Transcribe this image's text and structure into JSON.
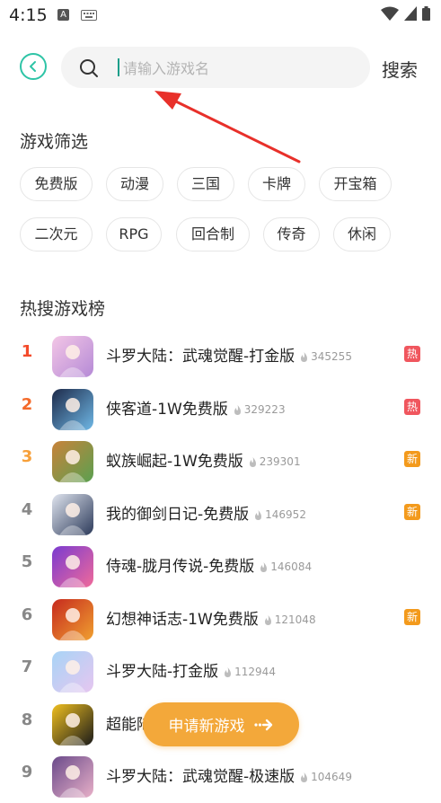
{
  "status_bar": {
    "time": "4:15",
    "a_icon": "A"
  },
  "search": {
    "placeholder": "请输入游戏名",
    "button_label": "搜索"
  },
  "filter": {
    "title": "游戏筛选",
    "tags": [
      "免费版",
      "动漫",
      "三国",
      "卡牌",
      "开宝箱",
      "二次元",
      "RPG",
      "回合制",
      "传奇",
      "休闲"
    ]
  },
  "ranking": {
    "title": "热搜游戏榜",
    "items": [
      {
        "rank": "1",
        "name": "斗罗大陆：武魂觉醒-打金版",
        "count": "345255",
        "badge": "热",
        "badge_color": "#f0565e",
        "thumb_colors": [
          "#f3c6e6",
          "#b58ad6"
        ]
      },
      {
        "rank": "2",
        "name": "侠客道-1W免费版",
        "count": "329223",
        "badge": "热",
        "badge_color": "#f0565e",
        "thumb_colors": [
          "#1d2a4a",
          "#6fb8e6"
        ]
      },
      {
        "rank": "3",
        "name": "蚁族崛起-1W免费版",
        "count": "239301",
        "badge": "新",
        "badge_color": "#f39a1c",
        "thumb_colors": [
          "#c8823a",
          "#5aa050"
        ]
      },
      {
        "rank": "4",
        "name": "我的御剑日记-免费版",
        "count": "146952",
        "badge": "新",
        "badge_color": "#f39a1c",
        "thumb_colors": [
          "#dfe4ee",
          "#2c3a5a"
        ]
      },
      {
        "rank": "5",
        "name": "侍魂-胧月传说-免费版",
        "count": "146084",
        "badge": "",
        "badge_color": "",
        "thumb_colors": [
          "#7a3bd0",
          "#f06a9a"
        ]
      },
      {
        "rank": "6",
        "name": "幻想神话志-1W免费版",
        "count": "121048",
        "badge": "新",
        "badge_color": "#f39a1c",
        "thumb_colors": [
          "#c62a1e",
          "#f0a030"
        ]
      },
      {
        "rank": "7",
        "name": "斗罗大陆-打金版",
        "count": "112944",
        "badge": "",
        "badge_color": "",
        "thumb_colors": [
          "#a8d4f6",
          "#e6c6f0"
        ]
      },
      {
        "rank": "8",
        "name": "超能陆",
        "count": "",
        "badge": "",
        "badge_color": "",
        "thumb_colors": [
          "#f0c020",
          "#1a1a1a"
        ]
      },
      {
        "rank": "9",
        "name": "斗罗大陆：武魂觉醒-极速版",
        "count": "104649",
        "badge": "",
        "badge_color": "",
        "thumb_colors": [
          "#6a4a8a",
          "#e8b0c8"
        ]
      }
    ]
  },
  "apply_button": {
    "label": "申请新游戏"
  },
  "colors": {
    "accent": "#2ec4a6",
    "apply": "#f3a83a",
    "hot": "#f0565e",
    "new": "#f39a1c"
  }
}
